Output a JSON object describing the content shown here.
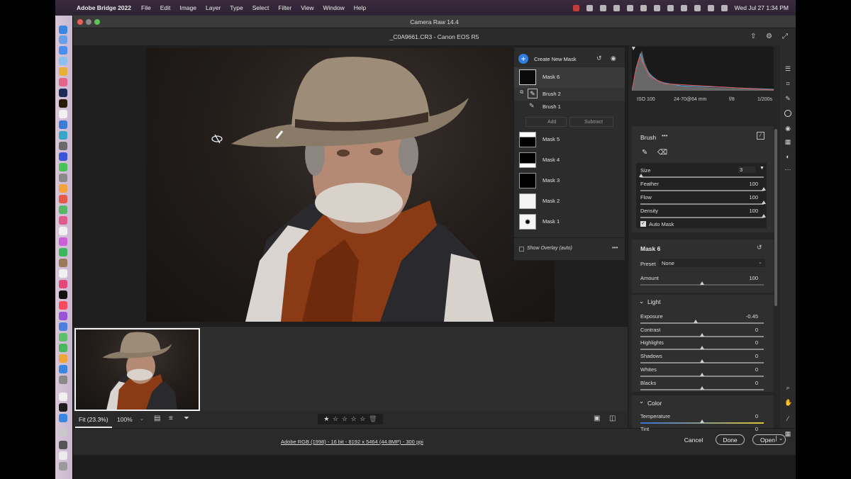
{
  "menubar": {
    "app_name": "Adobe Bridge 2022",
    "menus": [
      "File",
      "Edit",
      "Image",
      "Layer",
      "Type",
      "Select",
      "Filter",
      "View",
      "Window",
      "Help"
    ],
    "clock": "Wed Jul 27  1:34 PM"
  },
  "window": {
    "title": "Camera Raw 14.4",
    "file_title": "_C0A9661.CR3  -  Canon EOS R5"
  },
  "mask_panel": {
    "create_label": "Create New Mask",
    "masks": [
      {
        "label": "Mask 6"
      },
      {
        "label": "Brush 2"
      },
      {
        "label": "Brush 1"
      },
      {
        "label": "Mask 5"
      },
      {
        "label": "Mask 4"
      },
      {
        "label": "Mask 3"
      },
      {
        "label": "Mask 2"
      },
      {
        "label": "Mask 1"
      }
    ],
    "add_label": "Add",
    "subtract_label": "Subtract",
    "show_overlay_label": "Show Overlay (auto)"
  },
  "exif": {
    "iso": "ISO 100",
    "lens": "24-70@64 mm",
    "aperture": "f/8",
    "shutter": "1/200s"
  },
  "brush": {
    "title": "Brush",
    "more": "•••",
    "size_label": "Size",
    "size_value": "3",
    "feather_label": "Feather",
    "feather_value": "100",
    "flow_label": "Flow",
    "flow_value": "100",
    "density_label": "Density",
    "density_value": "100",
    "auto_mask_label": "Auto Mask",
    "auto_mask_checked": true
  },
  "mask_settings": {
    "title": "Mask 6",
    "preset_label": "Preset",
    "preset_value": "None",
    "amount_label": "Amount",
    "amount_value": "100"
  },
  "light": {
    "title": "Light",
    "sliders": [
      {
        "label": "Exposure",
        "value": "-0.45",
        "pos": 0.45
      },
      {
        "label": "Contrast",
        "value": "0",
        "pos": 0.5
      },
      {
        "label": "Highlights",
        "value": "0",
        "pos": 0.5
      },
      {
        "label": "Shadows",
        "value": "0",
        "pos": 0.5
      },
      {
        "label": "Whites",
        "value": "0",
        "pos": 0.5
      },
      {
        "label": "Blacks",
        "value": "0",
        "pos": 0.5
      }
    ]
  },
  "color": {
    "title": "Color",
    "temperature_label": "Temperature",
    "temperature_value": "0",
    "tint_label": "Tint",
    "tint_value": "0"
  },
  "bottombar": {
    "fit_label": "Fit (23.3%)",
    "zoom_label": "100%",
    "stars": [
      "★",
      "☆",
      "☆",
      "☆",
      "☆",
      "☆"
    ]
  },
  "status": {
    "info_link": "Adobe RGB (1998) - 16 bit - 8192 x 5464 (44.8MP) - 300 ppi",
    "cancel_label": "Cancel",
    "done_label": "Done",
    "open_label": "Open"
  },
  "colors": {
    "accent": "#2f7de1",
    "traffic_red": "#ee5f57",
    "traffic_yellow": "#f5bd4f",
    "traffic_green": "#5fc454"
  }
}
